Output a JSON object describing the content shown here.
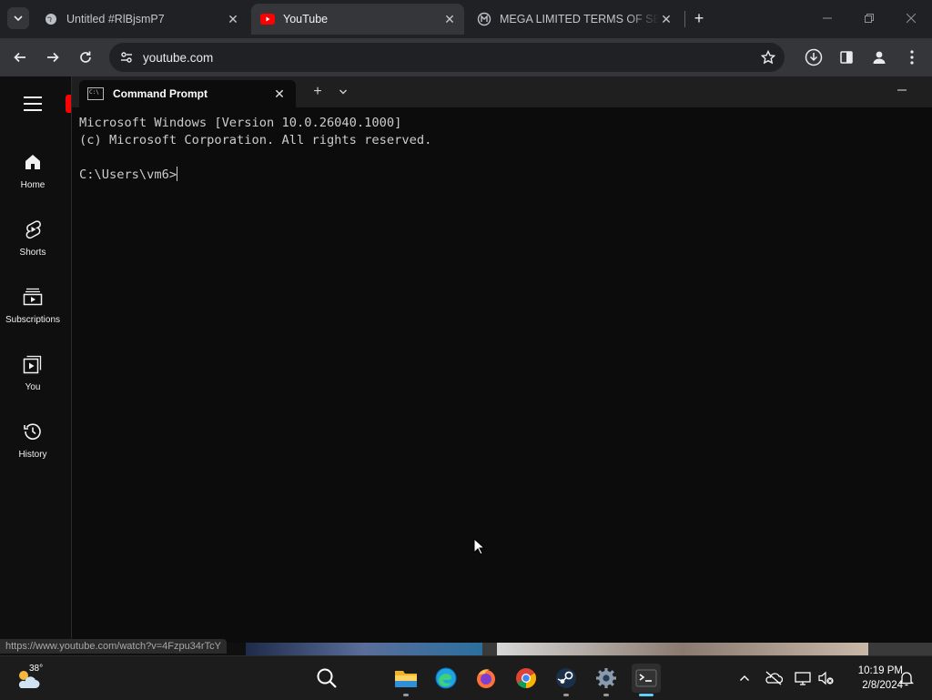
{
  "browser": {
    "tabs": [
      {
        "title": "Untitled #RlBjsmP7",
        "active": false,
        "favicon": "globe-icon"
      },
      {
        "title": "YouTube",
        "active": true,
        "favicon": "youtube-icon"
      },
      {
        "title": "MEGA LIMITED TERMS OF SERVICE",
        "active": false,
        "favicon": "mega-icon"
      }
    ],
    "address": "youtube.com",
    "status_url": "https://www.youtube.com/watch?v=4Fzpu34rTcY"
  },
  "youtube": {
    "guide": [
      {
        "label": "Home",
        "icon": "home-icon"
      },
      {
        "label": "Shorts",
        "icon": "shorts-icon"
      },
      {
        "label": "Subscriptions",
        "icon": "subscriptions-icon"
      },
      {
        "label": "You",
        "icon": "you-icon"
      },
      {
        "label": "History",
        "icon": "history-icon"
      }
    ]
  },
  "terminal": {
    "tab_title": "Command Prompt",
    "lines": [
      "Microsoft Windows [Version 10.0.26040.1000]",
      "(c) Microsoft Corporation. All rights reserved.",
      ""
    ],
    "prompt": "C:\\Users\\vm6>"
  },
  "taskbar": {
    "temperature": "38°",
    "time": "10:19 PM",
    "date": "2/8/2024"
  },
  "colors": {
    "terminal_bg": "#0c0c0c",
    "terminal_text": "#cccccc",
    "browser_frame": "#202124",
    "youtube_red": "#ff0000",
    "taskbar_bg": "#1c1c1c"
  }
}
